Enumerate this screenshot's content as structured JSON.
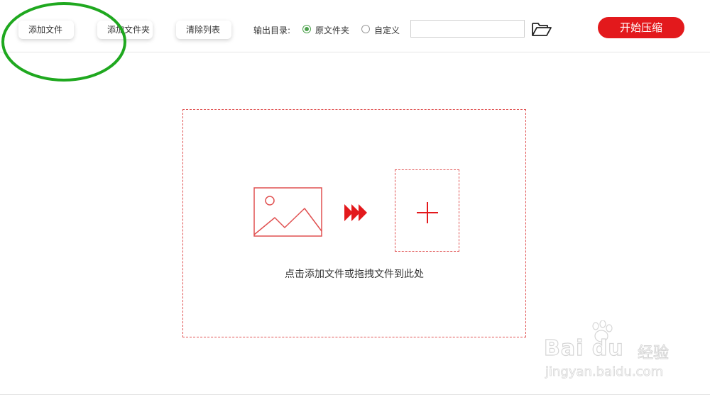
{
  "toolbar": {
    "add_file_label": "添加文件",
    "add_folder_label": "添加文件夹",
    "clear_list_label": "清除列表",
    "output_dir_label": "输出目录:",
    "radio_original_label": "原文件夹",
    "radio_custom_label": "自定义",
    "selected_output": "原文件夹",
    "path_value": "",
    "folder_icon": "folder-open-icon",
    "start_label": "开始压缩"
  },
  "drop_zone": {
    "hint": "点击添加文件或拖拽文件到此处",
    "icons": [
      "image-icon",
      "triple-arrow-icon",
      "plus-icon"
    ]
  },
  "watermark": {
    "brand": "Bai du",
    "sub": "经验",
    "url": "jingyan.baidu.com"
  },
  "colors": {
    "accent_red": "#e3191c",
    "dash_red": "#e05050",
    "radio_green": "#4fa34f",
    "annotation_green": "#1fa81f"
  }
}
